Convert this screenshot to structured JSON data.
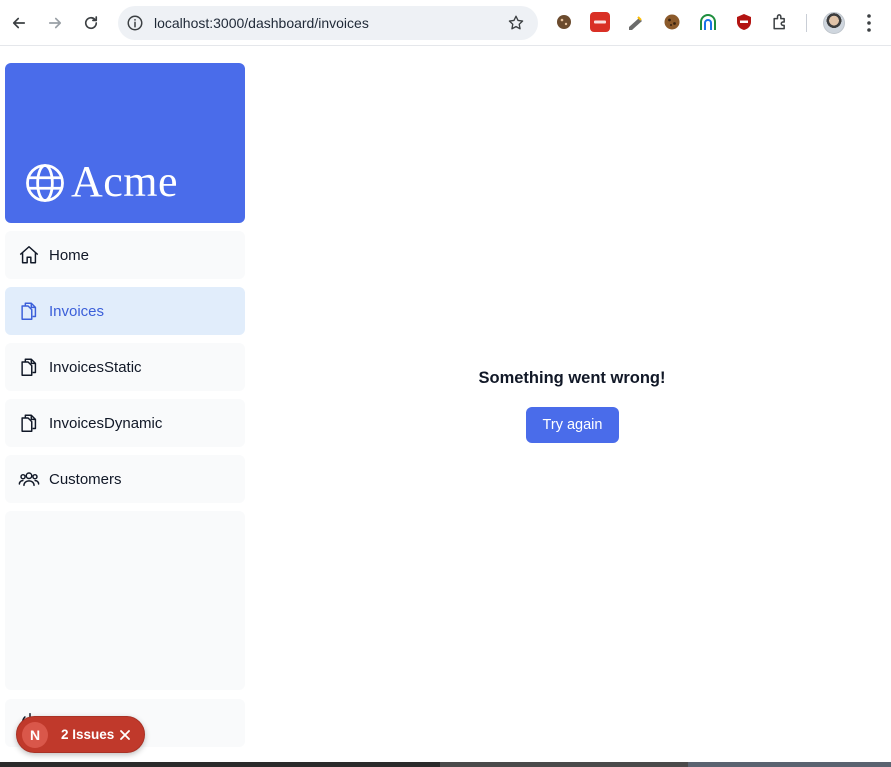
{
  "browser": {
    "url": "localhost:3000/dashboard/invoices",
    "icons": [
      "back-arrow-icon",
      "forward-arrow-icon",
      "reload-icon",
      "site-info-icon",
      "bookmark-star-icon",
      "extensions-puzzle-icon",
      "profile-avatar",
      "menu-dots-icon"
    ],
    "extension_colors": [
      "#6b4b2e",
      "#d93025",
      "#6b6b6b",
      "#8b5a2b",
      "#1e8e3e",
      "#b31412"
    ]
  },
  "brand": {
    "name": "Acme",
    "color": "#4a6cea"
  },
  "sidebar": {
    "items": [
      {
        "label": "Home",
        "icon": "home-icon",
        "active": false
      },
      {
        "label": "Invoices",
        "icon": "document-duplicate-icon",
        "active": true
      },
      {
        "label": "InvoicesStatic",
        "icon": "document-duplicate-icon",
        "active": false
      },
      {
        "label": "InvoicesDynamic",
        "icon": "document-duplicate-icon",
        "active": false
      },
      {
        "label": "Customers",
        "icon": "user-group-icon",
        "active": false
      }
    ],
    "signout_icon": "power-icon"
  },
  "error": {
    "message": "Something went wrong!",
    "button_label": "Try again"
  },
  "issues_toast": {
    "badge": "N",
    "label": "2 Issues",
    "color": "#c0392b"
  }
}
